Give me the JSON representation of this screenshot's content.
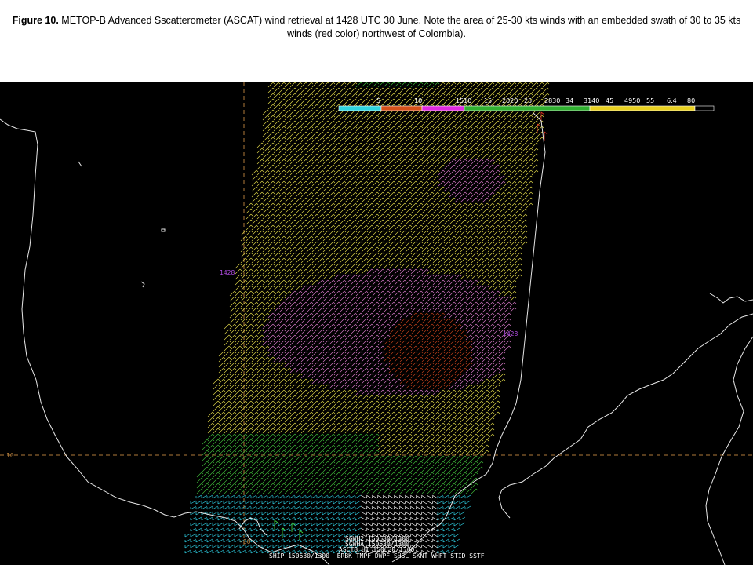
{
  "caption": {
    "figure_label": "Figure 10.",
    "text": "METOP-B Advanced Sscatterometer (ASCAT) wind retrieval at 1428 UTC 30 June. Note the area of 25-30 kts winds with an embedded swath of 30 to 35 kts winds (red color) northwest of Colombia)."
  },
  "map": {
    "time_labels": [
      "1428",
      "1428"
    ],
    "lat_label": "10",
    "lon_label": "-80",
    "station_lines": [
      "SGWH2 150630/1300",
      "SGWHA 150630/1300",
      "ASCTB HI 150630/1300",
      "SHIP 150630/1300  BRBK TMPF DWPF SHSL SKNT WHFT STID SSTF"
    ]
  },
  "wind_scale": {
    "ticks": [
      "5",
      "10",
      "1510",
      "15",
      "2020",
      "25",
      "2830",
      "34",
      "3140",
      "45",
      "4950",
      "55",
      "6.4",
      "80"
    ],
    "segments": [
      {
        "color": "#2fd4e0",
        "range": "0-5"
      },
      {
        "color": "#d4501a",
        "range": "5-10"
      },
      {
        "color": "#e02ae0",
        "range": "10-15"
      },
      {
        "color": "#30b030",
        "range": "15-34"
      },
      {
        "color": "#e8d020",
        "range": "34-64"
      },
      {
        "color": "#000000",
        "range": "64-80"
      }
    ]
  },
  "colors": {
    "background": "#000000",
    "coast": "#e8e8e8",
    "grid": "#b07a3a",
    "wind_yellow": "#e0d84a",
    "wind_green": "#3fb83a",
    "wind_cyan": "#30d4e8",
    "wind_pink": "#d87ac8",
    "wind_red": "#c0401c",
    "wind_white": "#ffffff"
  }
}
